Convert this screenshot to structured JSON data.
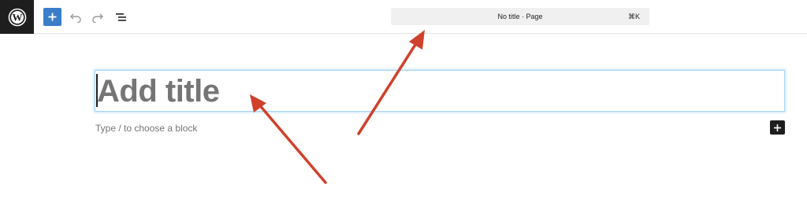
{
  "toolbar": {
    "logo_icon": "wordpress-icon",
    "add_block_icon": "plus-icon",
    "undo_icon": "undo-icon",
    "redo_icon": "redo-icon",
    "list_view_icon": "list-view-icon"
  },
  "command_bar": {
    "title": "No title · Page",
    "shortcut": "⌘K"
  },
  "editor": {
    "title_placeholder": "Add title",
    "block_prompt": "Type / to choose a block",
    "inline_add_icon": "plus-icon"
  },
  "colors": {
    "accent": "#3a7dc9",
    "dark": "#1e1e1e",
    "placeholder": "#757575",
    "annotation_arrow": "#d0412b",
    "focus_outline": "#aad4f5"
  }
}
